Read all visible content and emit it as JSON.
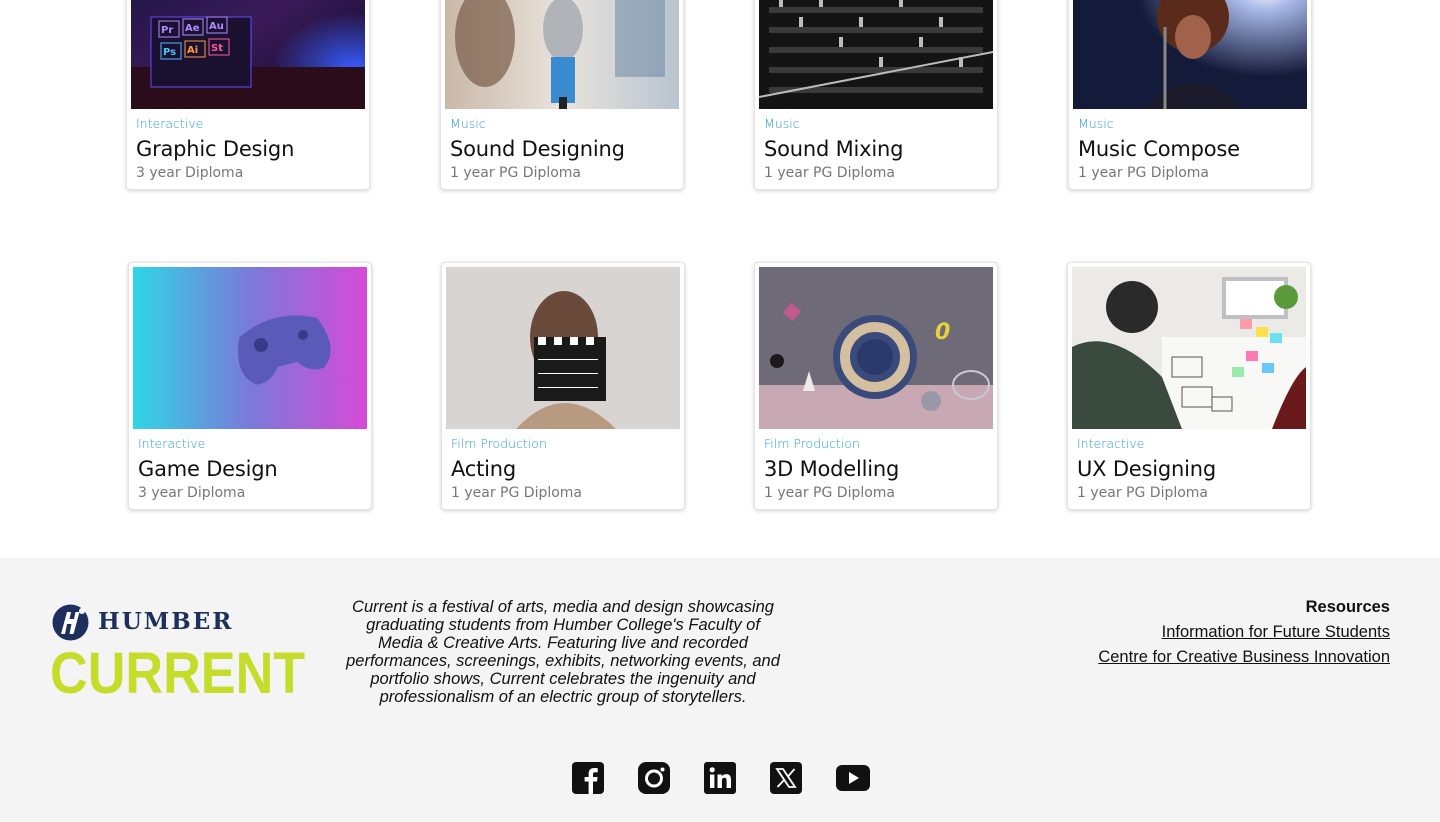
{
  "courses": [
    {
      "category": "Interactive",
      "title": "Graphic Design",
      "subtitle": "3 year  Diploma",
      "image": "graphic-design-photo"
    },
    {
      "category": "Music",
      "title": "Sound Designing",
      "subtitle": "1 year  PG Diploma",
      "image": "microphone-photo"
    },
    {
      "category": "Music",
      "title": "Sound Mixing",
      "subtitle": "1 year  PG Diploma",
      "image": "mixing-console-photo"
    },
    {
      "category": "Music",
      "title": "Music Compose",
      "subtitle": "1 year  PG Diploma",
      "image": "singer-photo"
    },
    {
      "category": "Interactive",
      "title": "Game Design",
      "subtitle": "3 year Diploma",
      "image": "game-controller-photo"
    },
    {
      "category": "Film Production",
      "title": "Acting",
      "subtitle": "1 year PG Diploma",
      "image": "clapperboard-photo"
    },
    {
      "category": "Film Production",
      "title": "3D Modelling",
      "subtitle": "1 year PG Diploma",
      "image": "3d-shapes-photo"
    },
    {
      "category": "Interactive",
      "title": "UX Designing",
      "subtitle": "1 year PG Diploma",
      "image": "ux-sketching-photo"
    }
  ],
  "footer": {
    "logo_humber": "HUMBER",
    "logo_current": "CURRENT",
    "blurb": "Current is a festival of arts, media and design showcasing graduating students from Humber College's Faculty of Media & Creative Arts. Featuring live and recorded performances, screenings, exhibits, networking events, and portfolio shows, Current celebrates the ingenuity and professionalism of an electric group of storytellers.",
    "resources_heading": "Resources",
    "links": [
      "Information for Future Students",
      "Centre for Creative Business Innovation"
    ],
    "socials": [
      "facebook-icon",
      "instagram-icon",
      "linkedin-icon",
      "x-icon",
      "youtube-icon"
    ]
  },
  "colors": {
    "category": "#2a9fd6",
    "current_logo": "#c6dc2b",
    "humber_navy": "#1d2f5c",
    "footer_bg": "#f4f4f4"
  }
}
